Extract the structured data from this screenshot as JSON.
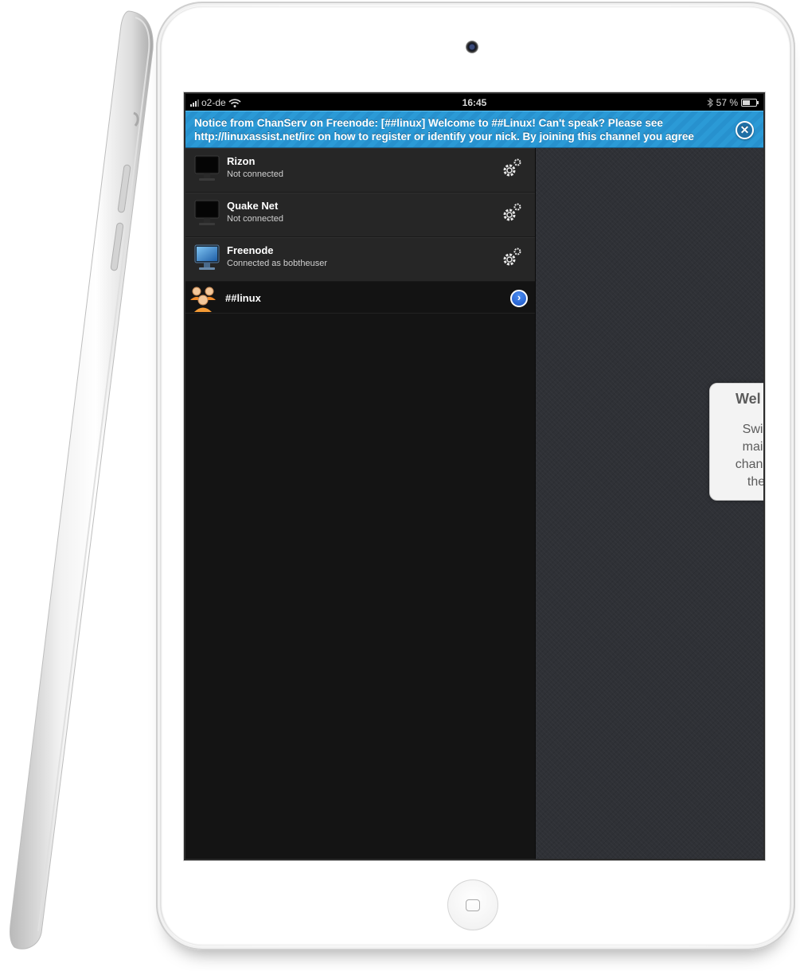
{
  "status_bar": {
    "carrier": "o2-de",
    "time": "16:45",
    "battery": "57 %",
    "battery_level": 0.57
  },
  "notice": {
    "line1": "Notice from ChanServ on Freenode: [##linux] Welcome to ##Linux! Can't speak? Please see",
    "line2": "http://linuxassist.net/irc on how to register or identify your nick. By joining this channel you agree",
    "close_icon": "close-icon"
  },
  "networks": [
    {
      "name": "Rizon",
      "status": "Not connected",
      "connected": false
    },
    {
      "name": "Quake Net",
      "status": "Not connected",
      "connected": false
    },
    {
      "name": "Freenode",
      "status": "Connected as bobtheuser",
      "connected": true
    }
  ],
  "channels": [
    {
      "name": "##linux"
    }
  ],
  "welcome": {
    "title": "Wel",
    "lines": [
      "Swip",
      "main",
      "channe",
      "the"
    ]
  },
  "colors": {
    "notice_blue": "#2b9ad6",
    "sidebar_row": "#262626",
    "content_bg": "#2f3136"
  }
}
